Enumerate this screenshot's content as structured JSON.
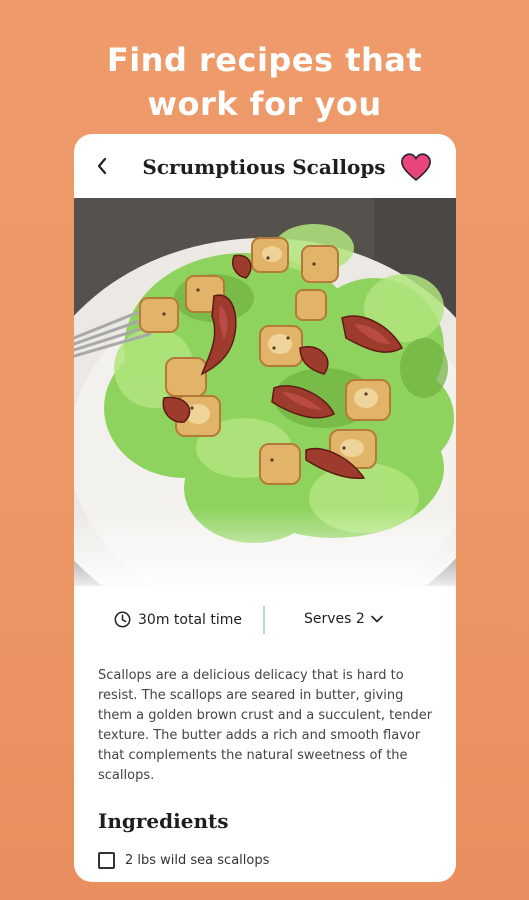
{
  "headline": {
    "line1": "Find recipes that",
    "line2": "work for you"
  },
  "recipe": {
    "back_icon": "chevron-left-icon",
    "title": "Scrumptious Scallops",
    "favorite_icon": "heart-icon",
    "favorite_color": "#e8457f",
    "time_label": "30m total time",
    "serves_label": "Serves 2",
    "description": "Scallops are a delicious delicacy that is hard to resist. The scallops are seared in butter, giving them a golden brown crust and a succulent, tender texture. The butter adds a rich and smooth flavor that complements the natural sweetness of the scallops.",
    "ingredients_heading": "Ingredients",
    "ingredients": [
      {
        "label": "2 lbs wild sea scallops",
        "checked": false
      }
    ]
  },
  "colors": {
    "background": "#ec9766",
    "card": "#ffffff",
    "divider": "#b9d4ea"
  }
}
